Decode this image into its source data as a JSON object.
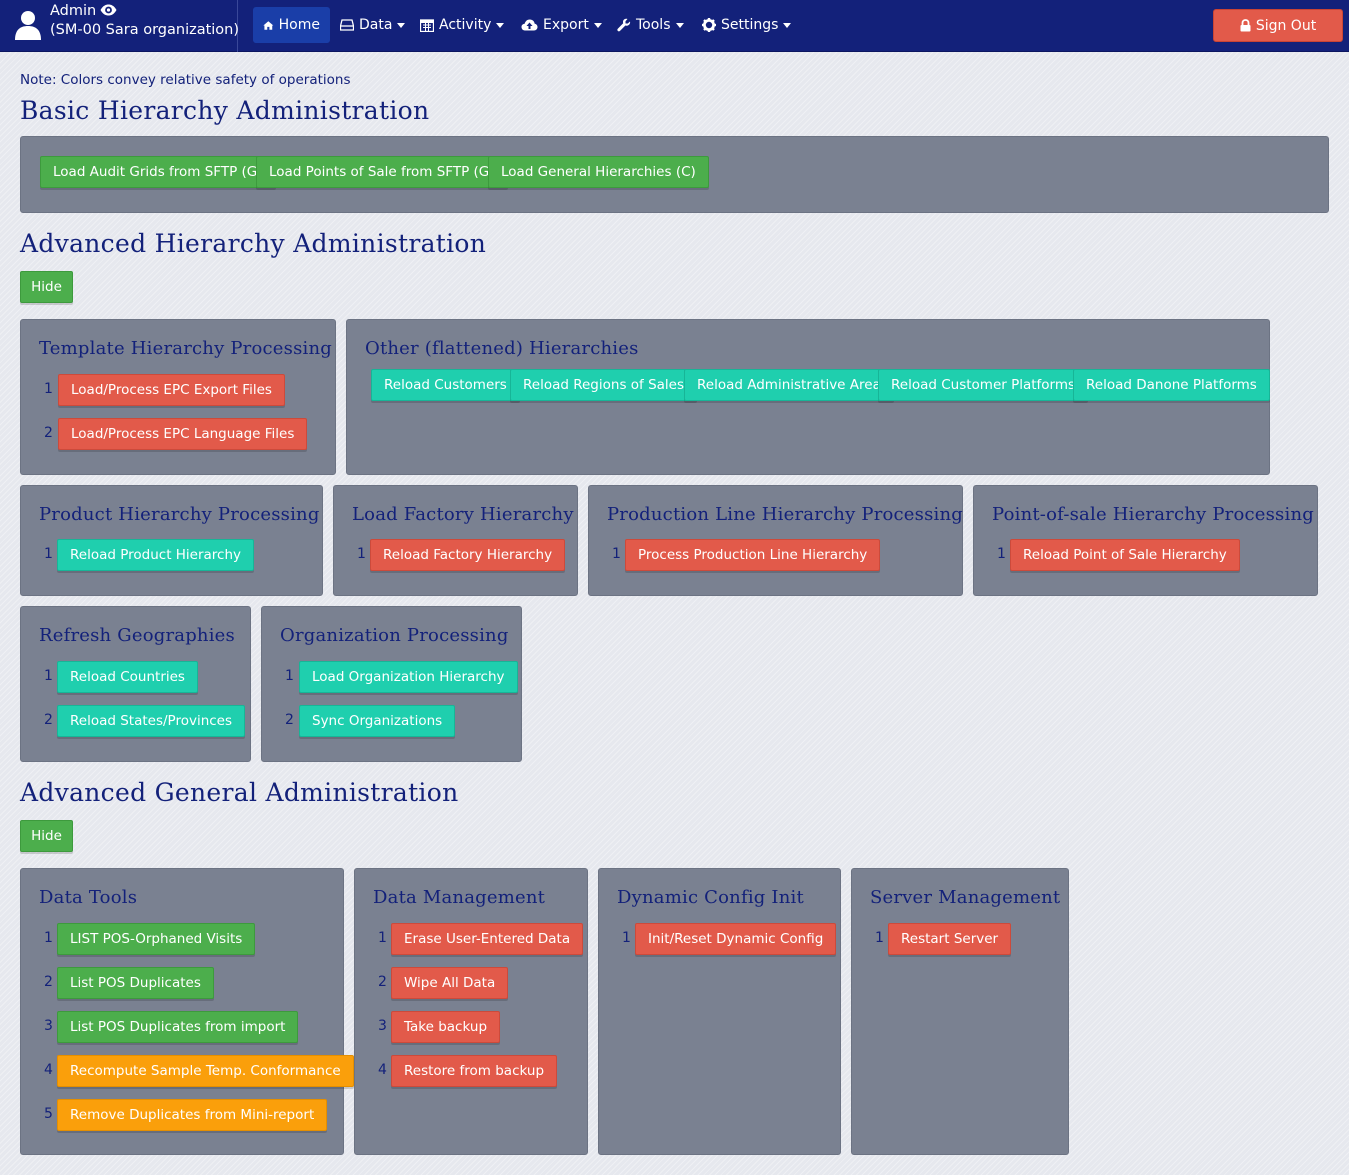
{
  "navbar": {
    "user_name": "Admin",
    "user_org": "(SM-00 Sara organization)",
    "items": [
      {
        "label": "Home",
        "icon": "home-icon"
      },
      {
        "label": "Data",
        "icon": "drive-icon"
      },
      {
        "label": "Activity",
        "icon": "calendar-icon"
      },
      {
        "label": "Export",
        "icon": "cloud-upload-icon"
      },
      {
        "label": "Tools",
        "icon": "wrench-icon"
      },
      {
        "label": "Settings",
        "icon": "gear-icon"
      }
    ],
    "signout_label": "Sign Out"
  },
  "colors": {
    "navbar": "#13217a",
    "green": "#4cae4c",
    "red": "#e25a4a",
    "teal": "#1fcfae",
    "orange": "#fa9f0b",
    "panel": "#7a8191"
  },
  "note": "Note: Colors convey relative safety of operations",
  "basic": {
    "title": "Basic Hierarchy Administration",
    "buttons": [
      "Load Audit Grids from SFTP (G)",
      "Load Points of Sale from SFTP (G)",
      "Load General Hierarchies (C)"
    ]
  },
  "advanced_hierarchy": {
    "title": "Advanced Hierarchy Administration",
    "hide_label": "Hide",
    "template": {
      "title": "Template Hierarchy Processing",
      "items": [
        {
          "num": "1",
          "label": "Load/Process EPC Export Files"
        },
        {
          "num": "2",
          "label": "Load/Process EPC Language Files"
        }
      ]
    },
    "other": {
      "title": "Other (flattened) Hierarchies",
      "buttons": [
        "Reload Customers",
        "Reload Regions of Sales",
        "Reload Administrative Area",
        "Reload Customer Platforms",
        "Reload Danone Platforms"
      ]
    },
    "product": {
      "title": "Product Hierarchy Processing",
      "items": [
        {
          "num": "1",
          "label": "Reload Product Hierarchy"
        }
      ]
    },
    "factory": {
      "title": "Load Factory Hierarchy",
      "items": [
        {
          "num": "1",
          "label": "Reload Factory Hierarchy"
        }
      ]
    },
    "production": {
      "title": "Production Line Hierarchy Processing",
      "items": [
        {
          "num": "1",
          "label": "Process Production Line Hierarchy"
        }
      ]
    },
    "pos": {
      "title": "Point-of-sale Hierarchy Processing",
      "items": [
        {
          "num": "1",
          "label": "Reload Point of Sale Hierarchy"
        }
      ]
    },
    "geo": {
      "title": "Refresh Geographies",
      "items": [
        {
          "num": "1",
          "label": "Reload Countries"
        },
        {
          "num": "2",
          "label": "Reload States/Provinces"
        }
      ]
    },
    "org": {
      "title": "Organization Processing",
      "items": [
        {
          "num": "1",
          "label": "Load Organization Hierarchy"
        },
        {
          "num": "2",
          "label": "Sync Organizations"
        }
      ]
    }
  },
  "advanced_general": {
    "title": "Advanced General Administration",
    "hide_label": "Hide",
    "data_tools": {
      "title": "Data Tools",
      "items": [
        {
          "num": "1",
          "label": "LIST POS-Orphaned Visits"
        },
        {
          "num": "2",
          "label": "List POS Duplicates"
        },
        {
          "num": "3",
          "label": "List POS Duplicates from import"
        },
        {
          "num": "4",
          "label": "Recompute Sample Temp. Conformance"
        },
        {
          "num": "5",
          "label": "Remove Duplicates from Mini-report"
        }
      ]
    },
    "data_mgmt": {
      "title": "Data Management",
      "items": [
        {
          "num": "1",
          "label": "Erase User-Entered Data"
        },
        {
          "num": "2",
          "label": "Wipe All Data"
        },
        {
          "num": "3",
          "label": "Take backup"
        },
        {
          "num": "4",
          "label": "Restore from backup"
        }
      ]
    },
    "dyn_config": {
      "title": "Dynamic Config Init",
      "items": [
        {
          "num": "1",
          "label": "Init/Reset Dynamic Config"
        }
      ]
    },
    "server": {
      "title": "Server Management",
      "items": [
        {
          "num": "1",
          "label": "Restart Server"
        }
      ]
    }
  }
}
